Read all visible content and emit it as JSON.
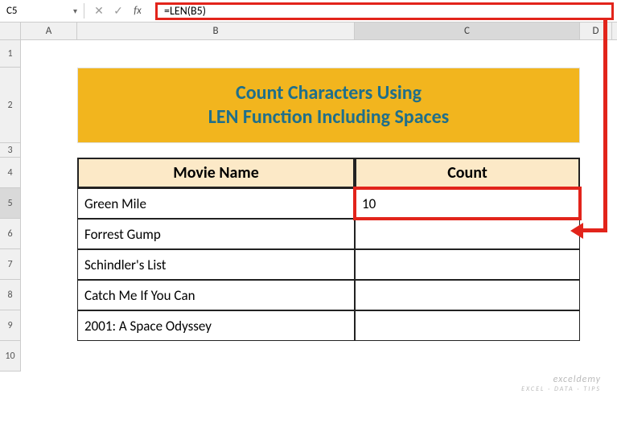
{
  "formula_bar": {
    "name_box": "C5",
    "fx_label": "fx",
    "formula": "=LEN(B5)"
  },
  "columns": {
    "A": "A",
    "B": "B",
    "C": "C",
    "D": "D"
  },
  "row_labels": [
    "1",
    "2",
    "3",
    "4",
    "5",
    "6",
    "7",
    "8",
    "9",
    "10"
  ],
  "title": "Count Characters Using\nLEN Function Including Spaces",
  "headers": {
    "b": "Movie Name",
    "c": "Count"
  },
  "rows": [
    {
      "b": "Green Mile",
      "c": "10"
    },
    {
      "b": "Forrest Gump",
      "c": ""
    },
    {
      "b": "Schindler's List",
      "c": ""
    },
    {
      "b": "Catch  Me If You Can",
      "c": ""
    },
    {
      "b": "2001: A Space Odyssey",
      "c": ""
    }
  ],
  "watermark": {
    "main": "exceldemy",
    "sub": "EXCEL · DATA · TIPS"
  }
}
